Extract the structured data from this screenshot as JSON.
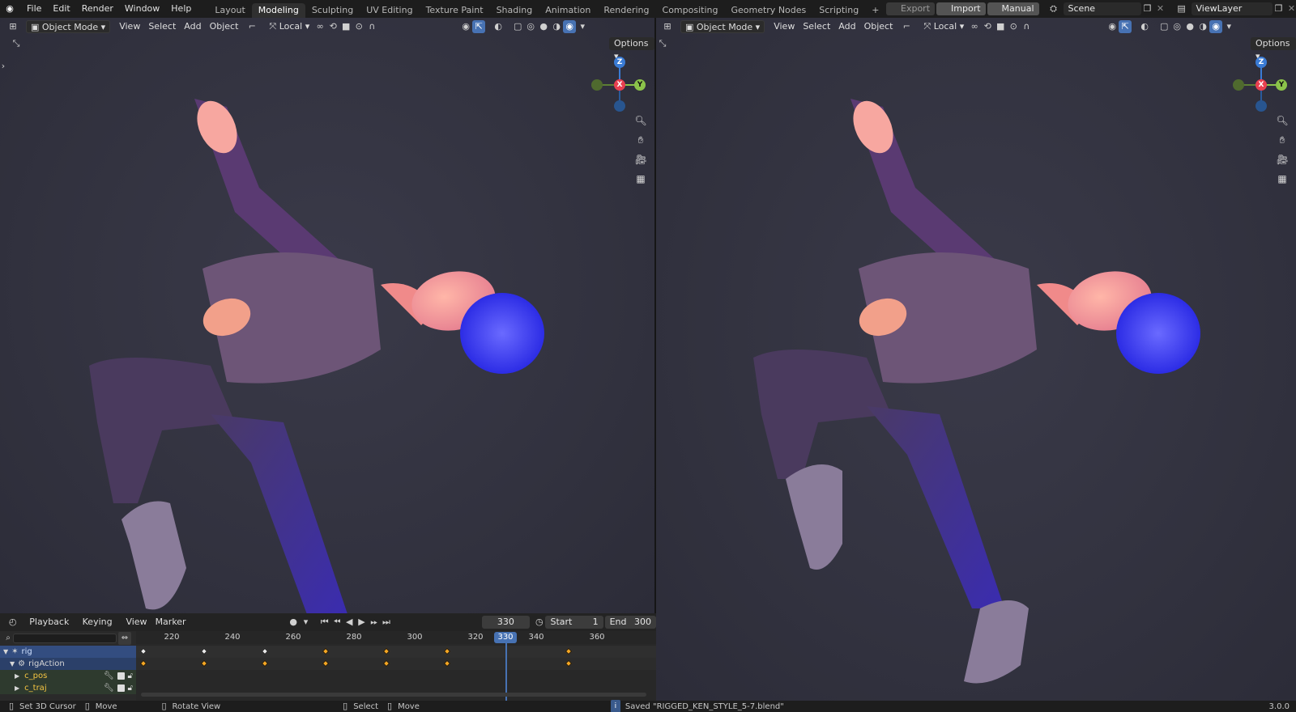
{
  "topbar": {
    "menu": [
      "File",
      "Edit",
      "Render",
      "Window",
      "Help"
    ],
    "workspaces": [
      "Layout",
      "Modeling",
      "Sculpting",
      "UV Editing",
      "Texture Paint",
      "Shading",
      "Animation",
      "Rendering",
      "Compositing",
      "Geometry Nodes",
      "Scripting"
    ],
    "active_workspace": "Modeling",
    "add_workspace": "+",
    "export_label": "Export",
    "import_label": "Import",
    "manual_label": "Manual",
    "scene_name": "Scene",
    "view_layer": "ViewLayer"
  },
  "viewport": {
    "mode": "Object Mode",
    "menus": [
      "View",
      "Select",
      "Add",
      "Object"
    ],
    "transform_orientation": "Local",
    "options_label": "Options",
    "gizmo": {
      "z": "Z",
      "y": "Y",
      "x": "X"
    }
  },
  "timeline": {
    "menus": [
      "Playback",
      "Keying",
      "View",
      "Marker"
    ],
    "current_frame": "330",
    "start_label": "Start",
    "start_value": "1",
    "end_label": "End",
    "end_value": "300",
    "frame_ticks": [
      "220",
      "240",
      "260",
      "280",
      "300",
      "320",
      "340",
      "360"
    ],
    "channels": [
      {
        "name": "rig",
        "color": "#cfe0ff"
      },
      {
        "name": "rigAction",
        "color": "#d6d6d6"
      },
      {
        "name": "c_pos",
        "color": "#f5c542"
      },
      {
        "name": "c_traj",
        "color": "#f5c542"
      }
    ]
  },
  "statusbar": {
    "set_cursor": "Set 3D Cursor",
    "move1": "Move",
    "rotate": "Rotate View",
    "select": "Select",
    "move2": "Move",
    "message": "Saved \"RIGGED_KEN_STYLE_5-7.blend\"",
    "version": "3.0.0"
  },
  "colors": {
    "active_frame": "#4772b3",
    "keyframe_orange": "#f5a623",
    "axis_x": "#e84050",
    "axis_y": "#8bc34a",
    "axis_z": "#3a7bd5"
  }
}
